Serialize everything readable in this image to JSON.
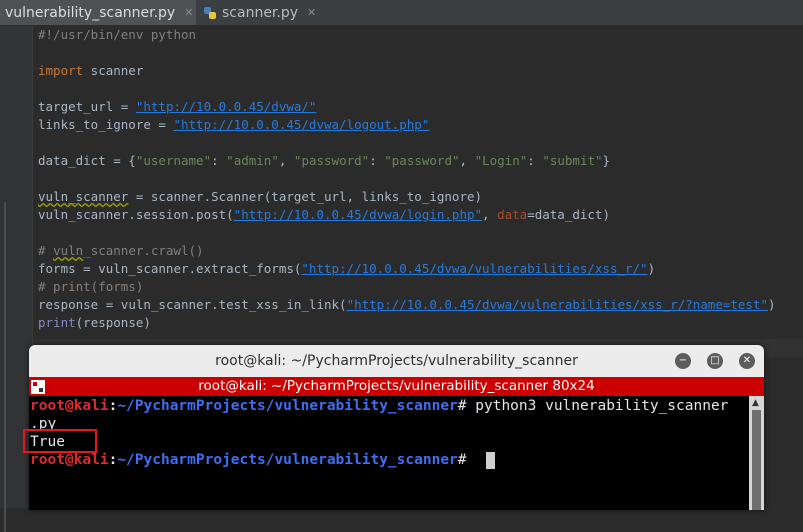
{
  "tabs": [
    {
      "label": "vulnerability_scanner.py",
      "active": true
    },
    {
      "label": "scanner.py",
      "active": false
    }
  ],
  "code": {
    "shebang": "#!/usr/bin/env python",
    "import_kw": "import",
    "import_mod": " scanner",
    "l_target_a": "target_url = ",
    "l_target_url": "\"http://10.0.0.45/dvwa/\"",
    "l_links_a": "links_to_ignore = ",
    "l_links_url": "\"http://10.0.0.45/dvwa/logout.php\"",
    "l_data_a": "data_dict = {",
    "l_data_k1": "\"username\"",
    "l_data_s1": ": ",
    "l_data_v1": "\"admin\"",
    "l_data_s2": ", ",
    "l_data_k2": "\"password\"",
    "l_data_s3": ": ",
    "l_data_v2": "\"password\"",
    "l_data_s4": ", ",
    "l_data_k3": "\"Login\"",
    "l_data_s5": ": ",
    "l_data_v3": "\"submit\"",
    "l_data_end": "}",
    "l_vs_var": "vuln_scanner",
    "l_vs_rest": " = scanner.Scanner(target_url, links_to_ignore)",
    "l_post_a": "vuln_scanner.session.post(",
    "l_post_url": "\"http://10.0.0.45/dvwa/login.php\"",
    "l_post_b": ", ",
    "l_post_param": "data",
    "l_post_c": "=data_dict)",
    "l_crawl_a": "# ",
    "l_crawl_warn": "vuln",
    "l_crawl_b": "_scanner.crawl()",
    "l_forms_a": "forms = vuln_scanner.extract_forms(",
    "l_forms_url": "\"http://10.0.0.45/dvwa/vulnerabilities/xss_r/\"",
    "l_forms_b": ")",
    "l_printforms": "# print(forms)",
    "l_resp_a": "response",
    "l_resp_b": " = vuln_scanner.test_xss_in_link(",
    "l_resp_url": "\"http://10.0.0.45/dvwa/vulnerabilities/xss_r/?name=test\"",
    "l_resp_c": ")",
    "l_print_fn": "print",
    "l_print_a": "(",
    "l_print_arg": "response",
    "l_print_b": ")"
  },
  "terminal": {
    "window_title": "root@kali: ~/PycharmProjects/vulnerability_scanner",
    "tab_title": "root@kali: ~/PycharmProjects/vulnerability_scanner 80x24",
    "user": "root@kali",
    "colon": ":",
    "path": "~/PycharmProjects/vulnerability_scanner",
    "prompt_end": "# ",
    "command": "python3 vulnerability_scanner",
    "command_wrap": ".py",
    "output": "True",
    "minimize_glyph": "−",
    "maximize_glyph": "□",
    "close_glyph": "✕"
  },
  "colors": {
    "highlight_box": "#e8141e",
    "terminal_tab_bar": "#cc0000"
  }
}
